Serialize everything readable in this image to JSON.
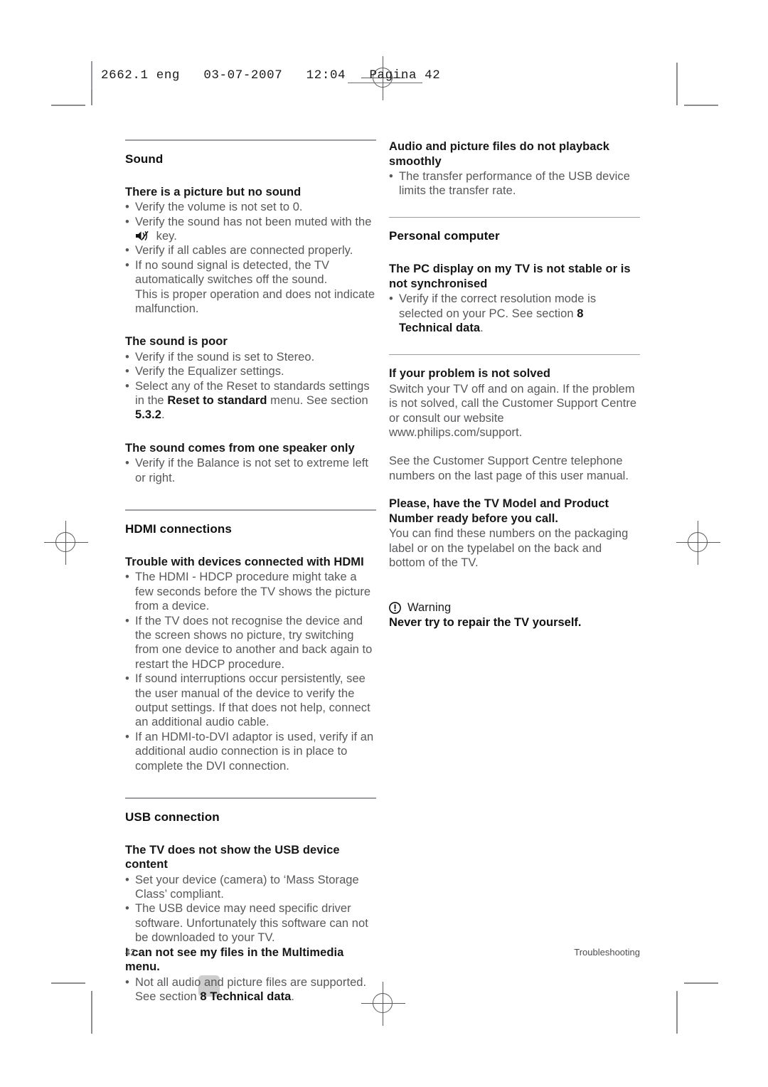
{
  "page": {
    "slug": "2662.1 eng   03-07-2007   12:04   Pagina 42",
    "footer_page_number": "42",
    "footer_chapter": "Troubleshooting"
  },
  "left_column": {
    "sound": {
      "title": "Sound",
      "groups": [
        {
          "heading": "There is a picture but no sound",
          "bullets": [
            {
              "text": "Verify the volume is not set to 0."
            },
            {
              "text": "Verify the sound has not been muted with the",
              "icon": "mute-icon",
              "text_after_icon": "key."
            },
            {
              "text": "Verify if all cables are connected properly."
            },
            {
              "text": "If no sound signal is detected, the TV automatically switches off the sound.",
              "continuation": "This is proper operation and does not indicate malfunction."
            }
          ]
        },
        {
          "heading": "The sound is poor",
          "bullets": [
            {
              "text": "Verify if the sound is set to Stereo."
            },
            {
              "text": "Verify the Equalizer settings."
            },
            {
              "text_parts": [
                {
                  "t": "Select any of the Reset to standards settings in the ",
                  "bold": false
                },
                {
                  "t": "Reset to standard",
                  "bold": true
                },
                {
                  "t": " menu. See section ",
                  "bold": false
                },
                {
                  "t": "5.3.2",
                  "bold": true
                },
                {
                  "t": ".",
                  "bold": false
                }
              ]
            }
          ]
        },
        {
          "heading": "The sound comes from one speaker only",
          "bullets": [
            {
              "text": "Verify if the Balance is not set to extreme left or right."
            }
          ]
        }
      ]
    },
    "hdmi": {
      "title": "HDMI connections",
      "groups": [
        {
          "heading": "Trouble with devices connected with HDMI",
          "bullets": [
            {
              "text": "The HDMI - HDCP procedure might take a few seconds before the TV shows the picture from a device."
            },
            {
              "text": "If the TV does not recognise the device and the screen shows no picture, try switching from one device to another and back again to restart the HDCP procedure."
            },
            {
              "text": "If sound interruptions occur persistently, see the user manual of the device to verify the output settings. If that does not help, connect an additional audio cable."
            },
            {
              "text": "If an HDMI-to-DVI adaptor is used, verify if an additional audio connection is in place to complete the DVI connection."
            }
          ]
        }
      ]
    },
    "usb": {
      "title": "USB connection",
      "groups": [
        {
          "heading": "The TV does not show the USB device content",
          "bullets": [
            {
              "text": "Set your device (camera) to ‘Mass Storage Class’ compliant."
            },
            {
              "text": "The USB device may need specific driver software. Unfortunately this software can not be downloaded to your TV."
            }
          ]
        },
        {
          "heading": "I can not see my files in the Multimedia menu.",
          "bullets": [
            {
              "text_parts": [
                {
                  "t": "Not all audio and picture files are supported. See section ",
                  "bold": false
                },
                {
                  "t": "8 Technical data",
                  "bold": true
                },
                {
                  "t": ".",
                  "bold": false
                }
              ]
            }
          ]
        }
      ]
    }
  },
  "right_column": {
    "playback": {
      "heading": "Audio and picture files do not playback smoothly",
      "bullets": [
        {
          "text": "The transfer performance of the USB device limits the transfer rate."
        }
      ]
    },
    "personal_computer": {
      "title": "Personal computer",
      "groups": [
        {
          "heading": "The PC display on my TV is not stable or is not synchronised",
          "bullets": [
            {
              "text_parts": [
                {
                  "t": "Verify if the correct resolution mode is selected on your PC. See section ",
                  "bold": false
                },
                {
                  "t": "8 Technical data",
                  "bold": true
                },
                {
                  "t": ".",
                  "bold": false
                }
              ]
            }
          ]
        }
      ]
    },
    "not_solved": {
      "title": "If your problem is not solved",
      "paragraph_1": "Switch your TV off and on again. If the problem is not solved, call the Customer Support Centre or consult our website www.philips.com/support.",
      "paragraph_2": "See the Customer Support Centre telephone numbers on the last page of this user manual.",
      "heading_3": "Please, have the TV Model and Product Number ready before you call.",
      "paragraph_3": "You can find these numbers on the packaging label or on the typelabel on the back and bottom of the TV.",
      "warning_label": "Warning",
      "warning_icon": "warning-icon",
      "warning_text": "Never try to repair the TV yourself."
    }
  },
  "colors": {
    "body_text": "#58585b",
    "heading_text": "#141414",
    "rule": "#9d9da1",
    "crop_mark": "#8d8d90",
    "gray_square": "#cdcdcd"
  }
}
